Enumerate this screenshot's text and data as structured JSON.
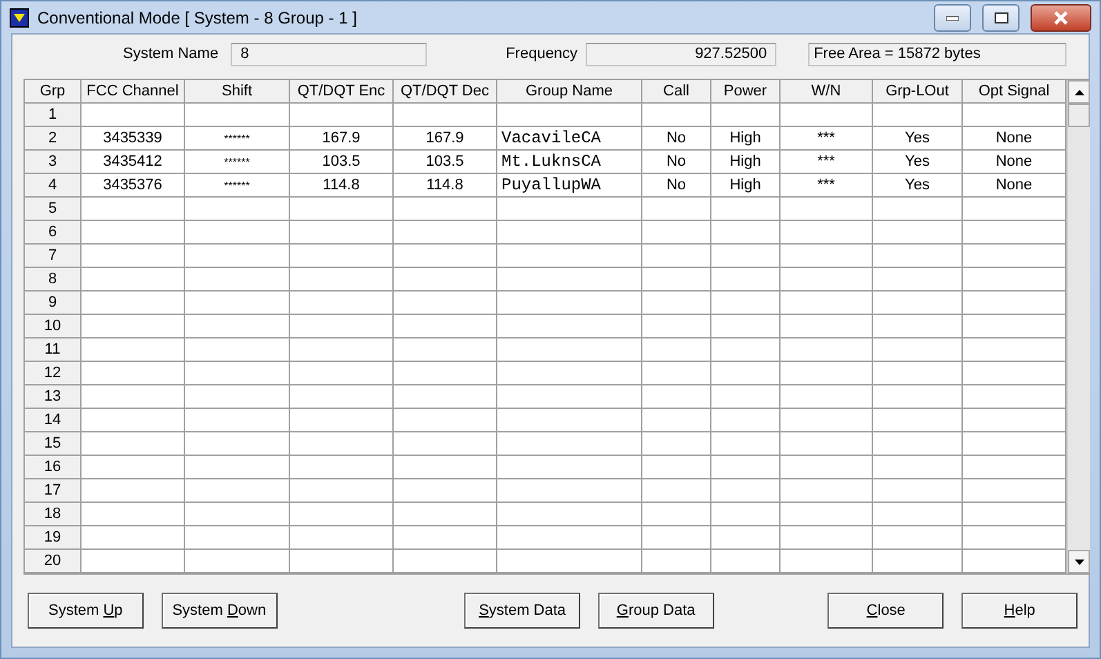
{
  "window": {
    "title": "Conventional Mode [ System - 8  Group - 1 ]"
  },
  "info": {
    "system_name_label": "System Name",
    "system_name": "8",
    "frequency_label": "Frequency",
    "frequency": "927.52500",
    "free_area": "Free Area = 15872 bytes"
  },
  "table": {
    "columns": [
      "Grp",
      "FCC Channel",
      "Shift",
      "QT/DQT Enc",
      "QT/DQT Dec",
      "Group Name",
      "Call",
      "Power",
      "W/N",
      "Grp-LOut",
      "Opt Signal"
    ],
    "rows": [
      {
        "grp": "1"
      },
      {
        "grp": "2",
        "fcc_channel": "3435339",
        "shift": "******",
        "enc": "167.9",
        "dec": "167.9",
        "group_name": "VacavileCA",
        "call": "No",
        "power": "High",
        "wn": "***",
        "grp_lout": "Yes",
        "opt_signal": "None"
      },
      {
        "grp": "3",
        "fcc_channel": "3435412",
        "shift": "******",
        "enc": "103.5",
        "dec": "103.5",
        "group_name": "Mt.LuknsCA",
        "call": "No",
        "power": "High",
        "wn": "***",
        "grp_lout": "Yes",
        "opt_signal": "None"
      },
      {
        "grp": "4",
        "fcc_channel": "3435376",
        "shift": "******",
        "enc": "114.8",
        "dec": "114.8",
        "group_name": "PuyallupWA",
        "call": "No",
        "power": "High",
        "wn": "***",
        "grp_lout": "Yes",
        "opt_signal": "None"
      },
      {
        "grp": "5"
      },
      {
        "grp": "6"
      },
      {
        "grp": "7"
      },
      {
        "grp": "8"
      },
      {
        "grp": "9"
      },
      {
        "grp": "10"
      },
      {
        "grp": "11"
      },
      {
        "grp": "12"
      },
      {
        "grp": "13"
      },
      {
        "grp": "14"
      },
      {
        "grp": "15"
      },
      {
        "grp": "16"
      },
      {
        "grp": "17"
      },
      {
        "grp": "18"
      },
      {
        "grp": "19"
      },
      {
        "grp": "20"
      }
    ]
  },
  "buttons": [
    {
      "pre": "System ",
      "key": "U",
      "post": "p"
    },
    {
      "pre": "System ",
      "key": "D",
      "post": "own"
    },
    {
      "key": "S",
      "post": "ystem Data"
    },
    {
      "key": "G",
      "post": "roup Data"
    },
    {
      "key": "C",
      "post": "lose"
    },
    {
      "key": "H",
      "post": "elp"
    }
  ]
}
